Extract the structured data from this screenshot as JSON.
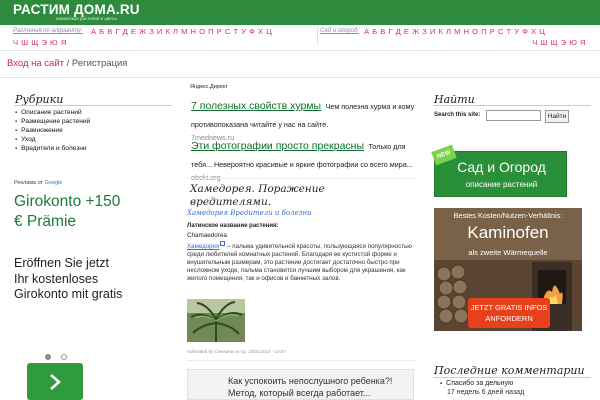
{
  "header": {
    "logo_title": "РАСТИМ ДОМА.RU",
    "logo_sub": "комнатные растения и цветы"
  },
  "alphabet_left": {
    "label": "Растения по алфавиту:",
    "line1": "А Б В Г Д Е Ж З И К Л М Н О П Р С Т У Ф Х Ц",
    "line2": "Ч Ш Щ Э Ю Я"
  },
  "alphabet_right": {
    "label": "Сад и огород:",
    "line1": "А Б В Г Д Е Ж З И К Л М Н О П Р С Т У Ф Х Ц",
    "line2": "Ч Ш Щ Э Ю Я"
  },
  "breadcrumb": {
    "login": "Вход на сайт",
    "separator": "/",
    "current": "Регистрация"
  },
  "rubriki": {
    "title": "Рубрики",
    "items": [
      "Описание растений",
      "Размещение растений",
      "Размножение",
      "Уход",
      "Вредители и болезни"
    ]
  },
  "google_ad": {
    "label_prefix": "Реклама от",
    "label_brand": "Google",
    "headline": "Girokonto +150 € Prämie",
    "body": "Eröffnen Sie jetzt Ihr kostenloses Girokonto mit gratis"
  },
  "yandex": {
    "label": "Яндекс.Директ",
    "ads": [
      {
        "title": "7 полезных свойств хурмы",
        "desc": "Чем полезна хурма и кому противопоказана читайте у нас на сайте.",
        "url": "7mednews.ru"
      },
      {
        "title": "Эти фотографии просто прекрасны",
        "desc": "Только для тебя... Невероятно красивые и яркие фотографии со всего мира...",
        "url": "oboki.org"
      }
    ]
  },
  "article": {
    "title": "Хамедорея. Поражение вредителями.",
    "category": "Хамедорея Вредители и болезни",
    "latin_label": "Латинское название растения:",
    "latin_value": "Chamaedorea",
    "body_link": "Хамедорея",
    "body_text": " – пальма удивительной красоты, пользующаяся популярностью среди любителей комнатных растений. Благодаря ее кустистой форме и внушительным размерам, это растение достигает достаточно быстро при несложном уходе, пальма становится лучшим выбором для украшения, как жилого помещения, так и офисов и банкетных залов.",
    "submitted": "Submitted by Снежана on ср, 10/01/2014 - 10:57"
  },
  "teaser": {
    "text": "Как успокоить непослушного ребенка?! Метод, который всегда работает..."
  },
  "search": {
    "title": "Найти",
    "label": "Search this site:",
    "value": "",
    "button": "Найти"
  },
  "banner_garden": {
    "badge": "NEW",
    "title": "Сад и Огород",
    "subtitle": "описание растений"
  },
  "banner_kaminofen": {
    "top": "Bestes Kosten/Nutzen-Verhältnis:",
    "title": "Kaminofen",
    "subtitle": "als zweite Wärmequelle",
    "button": "JETZT GRATIS INFOS ANFORDERN"
  },
  "comments": {
    "title": "Последние комментарии",
    "items": [
      {
        "text": "Спасибо за дельную",
        "meta": "17 недель 6 дней назад"
      }
    ]
  },
  "colors": {
    "header_green": "#2e8b3e",
    "link_pink": "#d0306a",
    "ad_green": "#1a7a3a",
    "link_blue": "#3a6ed0"
  }
}
